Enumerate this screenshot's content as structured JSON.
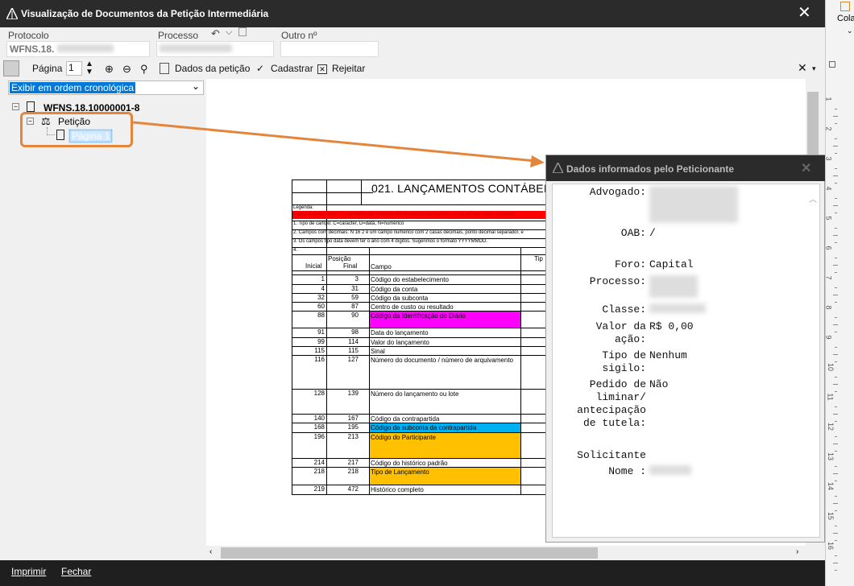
{
  "window": {
    "title": "Visualização de Documentos da Petição Intermediária",
    "close_glyph": "✕"
  },
  "fields": {
    "protocolo_label": "Protocolo",
    "protocolo_value": "WFNS.18.",
    "processo_label": "Processo",
    "outro_label": "Outro nº"
  },
  "toolbar": {
    "pagina_label": "Página",
    "pagina_value": "1",
    "dados_label": "Dados da petição",
    "cadastrar_label": "Cadastrar",
    "rejeitar_label": "Rejeitar"
  },
  "sort": {
    "selected": "Exibir em ordem cronológica"
  },
  "tree": {
    "root": "WFNS.18.10000001-8",
    "peticao": "Petição",
    "pagina": "Página 1"
  },
  "document": {
    "title": "021. LANÇAMENTOS CONTÁBEIS",
    "legenda": "Legenda:",
    "red_note": "Campos sinalizados em vermelho são inclusos em função do Ato Cotepe 70, os demais foram incluídos",
    "note1": "1. Tipo de campo: C=caracter, D=data, N=numérico",
    "note2": "2. Campos com decimais: N 16 2 é um campo numérico com 2 casas decimais, ponto decimal separador, e",
    "note3": "3. Os campos tipo data devem ter o ano com 4 dígitos. Sugerimos o formato YYYYMMDD.",
    "note4": "4.",
    "col_posicao": "Posição",
    "col_inicial": "Inicial",
    "col_final": "Final",
    "col_campo": "Campo",
    "col_tipo": "Tip",
    "rows": [
      {
        "ini": "1",
        "fin": "3",
        "campo": "Código do estabelecimento",
        "color": ""
      },
      {
        "ini": "4",
        "fin": "31",
        "campo": "Código da conta",
        "color": ""
      },
      {
        "ini": "32",
        "fin": "59",
        "campo": "Código da subconta",
        "color": ""
      },
      {
        "ini": "60",
        "fin": "87",
        "campo": "Centro de custo ou resultado",
        "color": ""
      },
      {
        "ini": "88",
        "fin": "90",
        "campo": "Código da Identificação do Diário",
        "color": "#ff00ff"
      },
      {
        "ini": "91",
        "fin": "98",
        "campo": "Data do lançamento",
        "color": ""
      },
      {
        "ini": "99",
        "fin": "114",
        "campo": "Valor do lançamento",
        "color": ""
      },
      {
        "ini": "115",
        "fin": "115",
        "campo": "Sinal",
        "color": ""
      },
      {
        "ini": "116",
        "fin": "127",
        "campo": "Número do documento / número de arquivamento",
        "color": ""
      },
      {
        "ini": "128",
        "fin": "139",
        "campo": "Número do lançamento ou lote",
        "color": ""
      },
      {
        "ini": "140",
        "fin": "167",
        "campo": "Código da contrapartida",
        "color": ""
      },
      {
        "ini": "168",
        "fin": "195",
        "campo": "Código da subconta da contrapartida",
        "color": "#00b0f0"
      },
      {
        "ini": "196",
        "fin": "213",
        "campo": "Código do Participante",
        "color": "#ffc000"
      },
      {
        "ini": "214",
        "fin": "217",
        "campo": "Código do histórico padrão",
        "color": ""
      },
      {
        "ini": "218",
        "fin": "218",
        "campo": "Tipo de Lançamento",
        "color": "#ffc000"
      },
      {
        "ini": "219",
        "fin": "472",
        "campo": "Histórico completo",
        "color": ""
      }
    ]
  },
  "popup": {
    "title": "Dados informados pelo Peticionante",
    "advogado_label": "Advogado:",
    "oab_label": "OAB:",
    "oab_value": "/",
    "foro_label": "Foro:",
    "foro_value": "Capital",
    "processo_label": "Processo:",
    "classe_label": "Classe:",
    "valor_label_1": "Valor da",
    "valor_label_2": "ação:",
    "valor_value": "R$ 0,00",
    "sigilo_label_1": "Tipo de",
    "sigilo_label_2": "sigilo:",
    "sigilo_value": "Nenhum",
    "pedido_label_1": "Pedido de",
    "pedido_label_2": "liminar/",
    "pedido_label_3": "antecipação",
    "pedido_label_4": "de tutela:",
    "pedido_value": "Não",
    "solicitante_label": "Solicitante",
    "nome_label": "Nome :"
  },
  "footer": {
    "imprimir": "Imprimir",
    "fechar": "Fechar"
  },
  "ribbon": {
    "cola_label": "Cola"
  },
  "ruler": {
    "numbers": [
      "1",
      "2",
      "3",
      "4",
      "5",
      "6",
      "7",
      "8",
      "9",
      "10",
      "11",
      "12",
      "13",
      "14",
      "15",
      "16"
    ]
  },
  "colors": {
    "titlebar": "#2b2b2b",
    "accent": "#0078d7",
    "callout": "#e3863c",
    "red_band": "#ff0000"
  }
}
